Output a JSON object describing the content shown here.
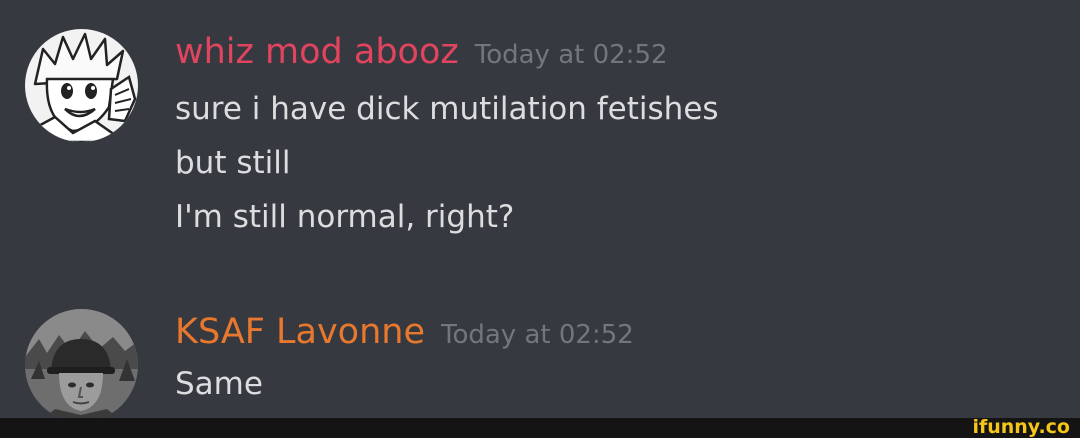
{
  "messages": [
    {
      "author": "whiz mod abooz",
      "author_color": "#e0445e",
      "timestamp": "Today at 02:52",
      "avatar_icon": "anime-character-avatar",
      "lines": [
        "sure i have dick mutilation fetishes",
        "but still",
        "I'm still normal, right?"
      ]
    },
    {
      "author": "KSAF Lavonne",
      "author_color": "#e8782e",
      "timestamp": "Today at 02:52",
      "avatar_icon": "soldier-helmet-avatar",
      "lines": [
        "Same"
      ]
    }
  ],
  "watermark": "ifunny.co",
  "colors": {
    "background": "#36393f",
    "message_text": "#dcddde",
    "timestamp": "#72767d",
    "watermark": "#f5c518"
  }
}
